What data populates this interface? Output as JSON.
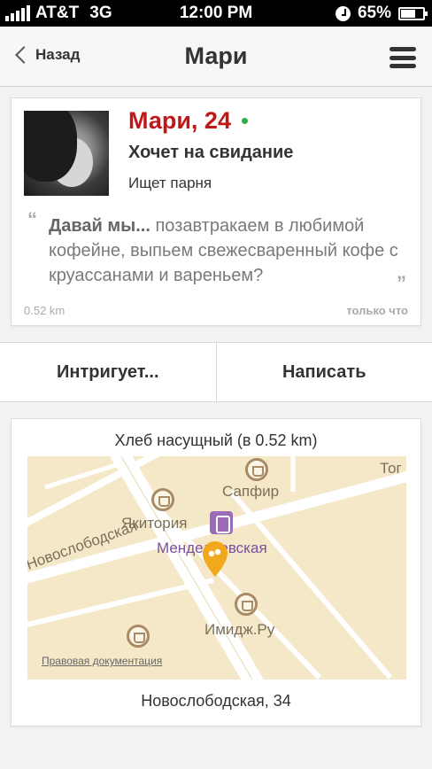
{
  "status_bar": {
    "carrier": "AT&T",
    "network": "3G",
    "time": "12:00 PM",
    "battery": "65%",
    "icons": [
      "signal-icon",
      "clock-icon",
      "battery-icon"
    ]
  },
  "nav": {
    "back_label": "Назад",
    "title": "Мари",
    "menu_icon": "hamburger-menu-icon"
  },
  "profile": {
    "name": "Мари, 24",
    "online": true,
    "online_color": "#27b34a",
    "name_color": "#c01818",
    "intent": "Хочет на свидание",
    "seeking": "Ищет парня",
    "message_lead": "Давай мы...",
    "message_text": " позавтракаем в любимой кофейне, выпьем свежесваренный кофе с круассанами и вареньем?",
    "distance": "0.52 km",
    "time_ago": "только что"
  },
  "actions": {
    "intrigue_label": "Интригует...",
    "write_label": "Написать"
  },
  "place": {
    "title": "Хлеб насущный (в 0.52 km)",
    "address": "Новослободская, 34",
    "pin_color": "#f2a81d",
    "map_labels": {
      "sapfir": "Сапфир",
      "yakitoriya": "Якитория",
      "mendeleevskaya": "Менделеевская",
      "novoslobodskaya": "Новослободская",
      "imidzh": "Имидж.Ру",
      "top_right": "Тог"
    },
    "legal_link": "Правовая документация"
  }
}
